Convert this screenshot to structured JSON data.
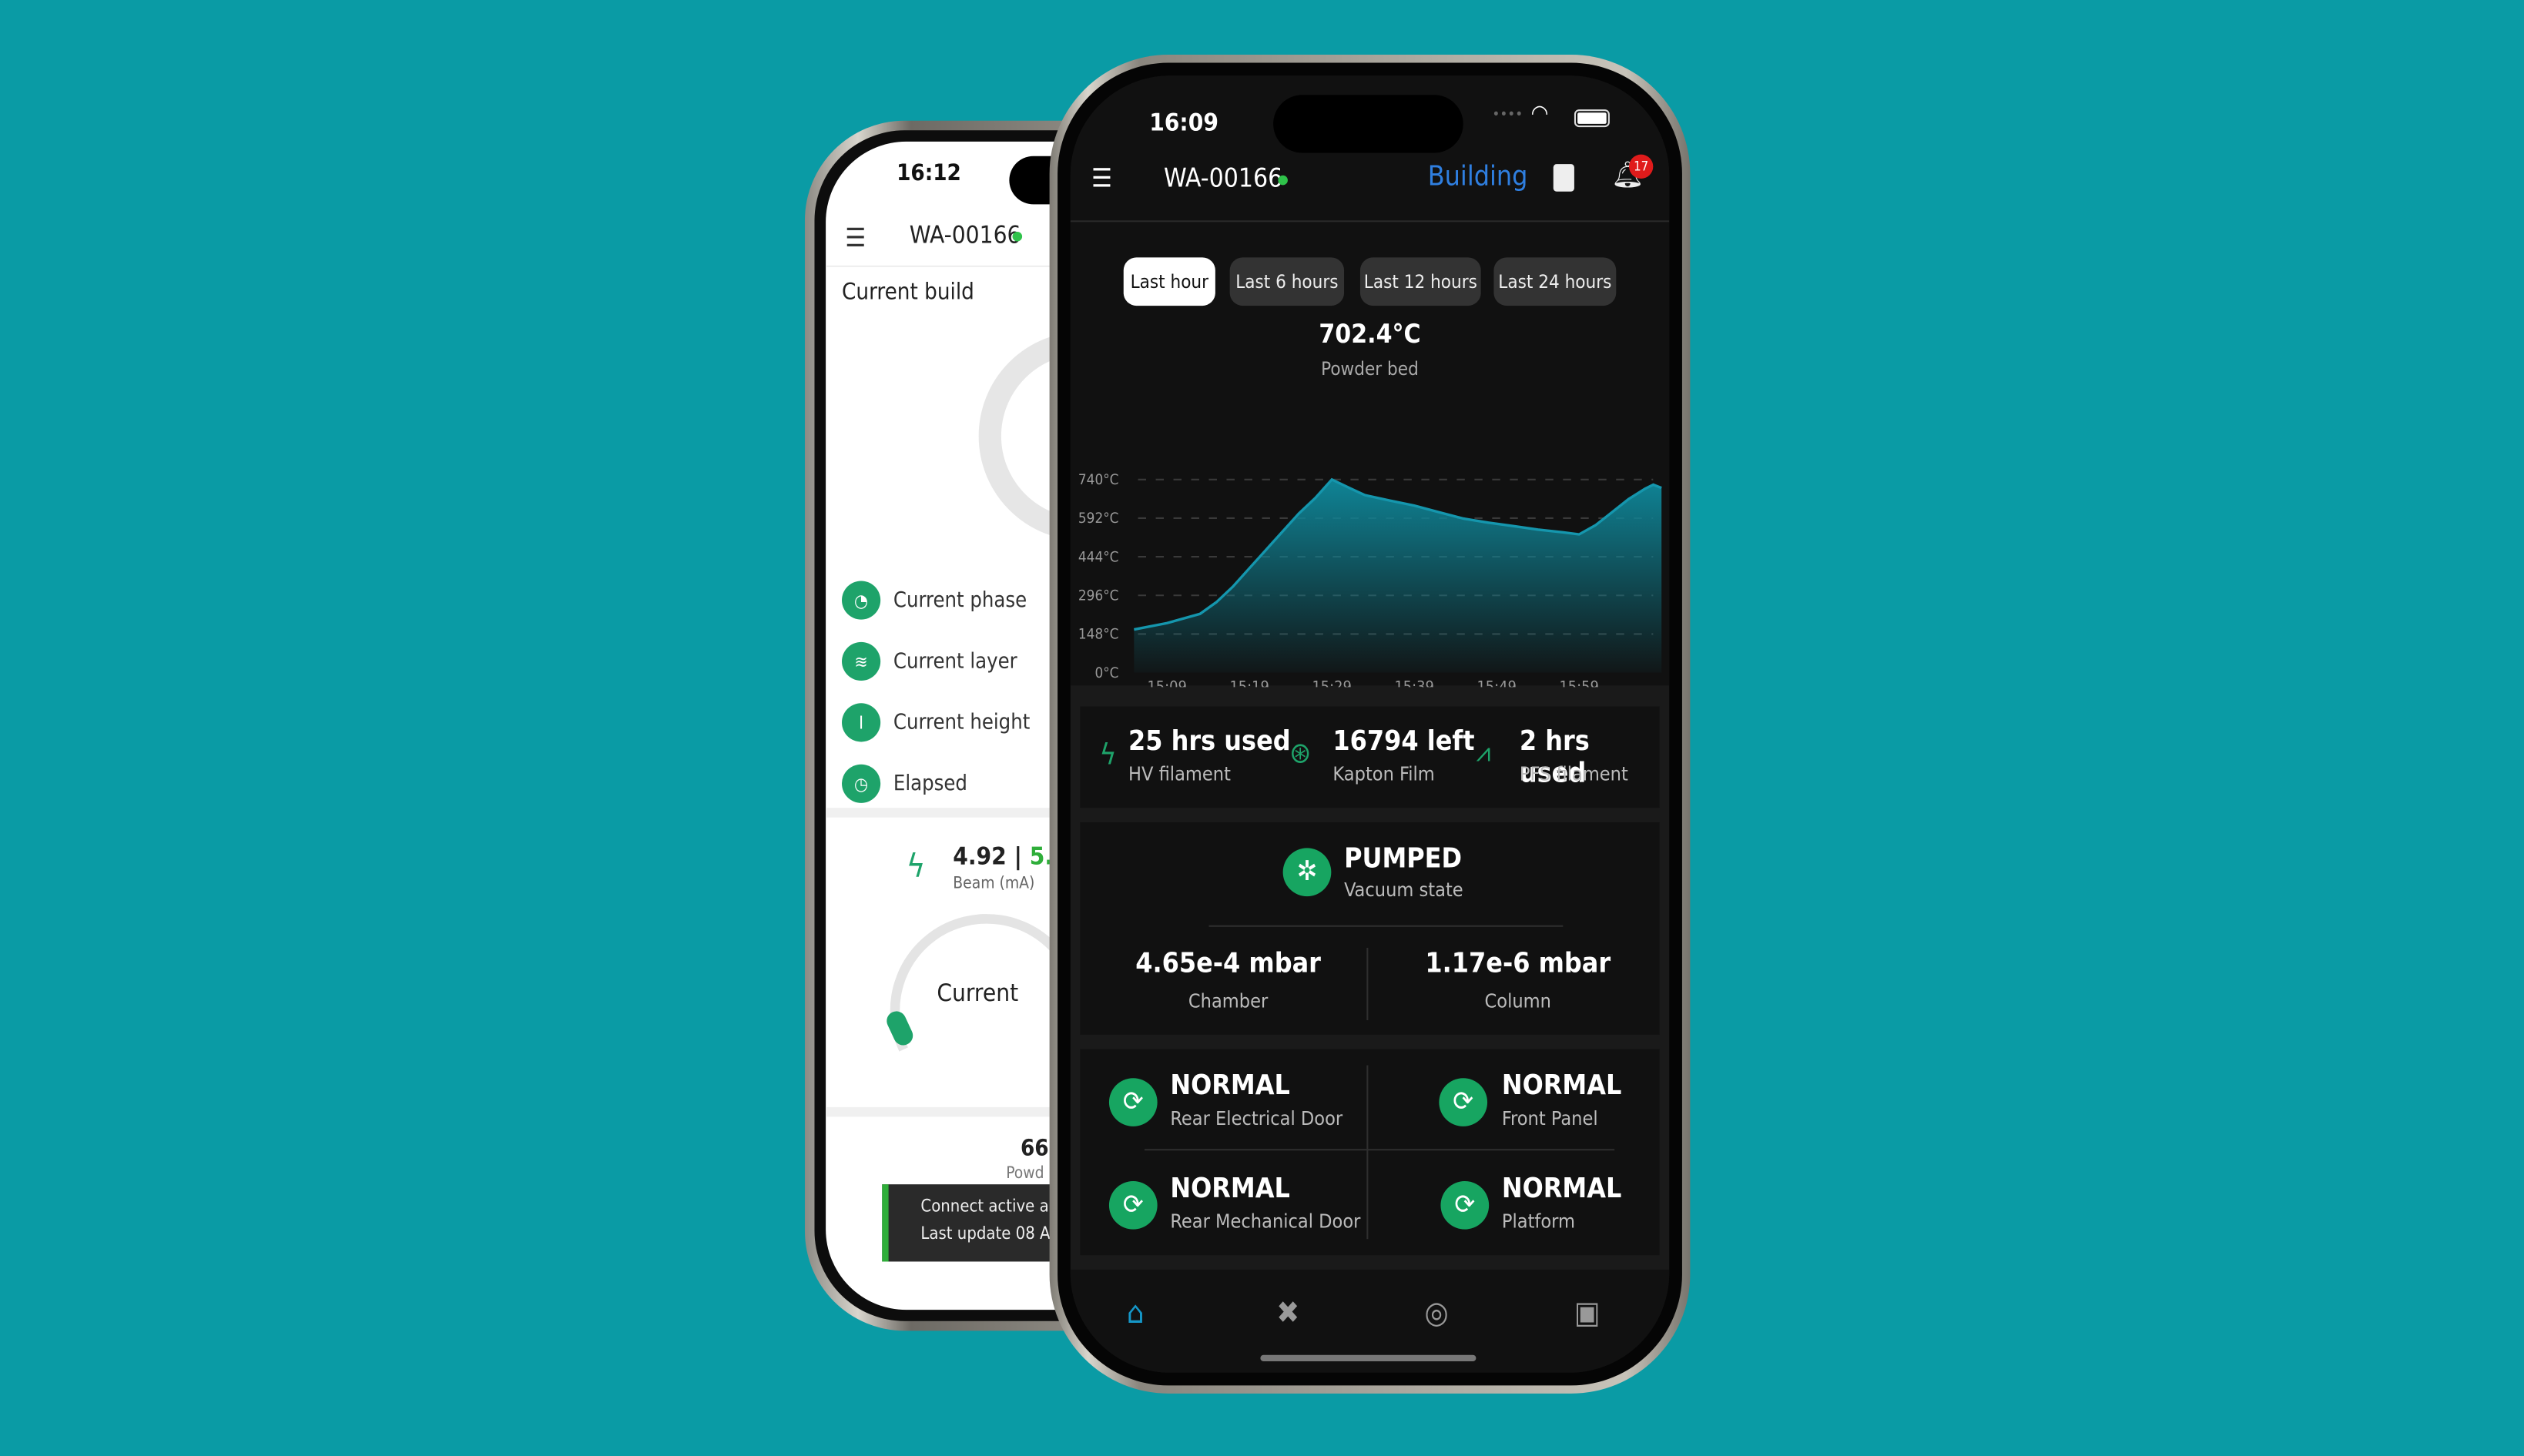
{
  "left_phone": {
    "status_time": "16:12",
    "device_id": "WA-00166",
    "section_title": "Current build",
    "info_rows": [
      {
        "label": "Current phase",
        "icon": "phase-icon"
      },
      {
        "label": "Current layer",
        "icon": "layers-icon"
      },
      {
        "label": "Current height",
        "icon": "height-icon"
      },
      {
        "label": "Elapsed",
        "icon": "clock-icon"
      }
    ],
    "beam_value": "4.92",
    "beam_separator": "|",
    "beam_target": "5.0",
    "beam_label": "Beam (mA)",
    "gauge_label": "Current",
    "partial_value": "66",
    "partial_label": "Powd",
    "toast_line1": "Connect active ar",
    "toast_line2": "Last update 08 Au"
  },
  "right_phone": {
    "status_time": "16:09",
    "device_id": "WA-00166",
    "online_color": "#2fc24a",
    "status": "Building",
    "status_color": "#2f7fe0",
    "notification_count": "17",
    "time_ranges": [
      "Last hour",
      "Last 6 hours",
      "Last 12 hours",
      "Last 24 hours"
    ],
    "selected_range": "Last hour",
    "current_value": "702.4°C",
    "current_label": "Powder bed",
    "consumables": [
      {
        "value": "25 hrs used",
        "label": "HV filament",
        "icon": "lightning-icon"
      },
      {
        "value": "16794 left",
        "label": "Kapton Film",
        "icon": "film-reel-icon"
      },
      {
        "value": "2 hrs used",
        "label": "PFS filament",
        "icon": "filament-icon"
      }
    ],
    "vacuum": {
      "state": "PUMPED",
      "label": "Vacuum state",
      "chamber_value": "4.65e-4 mbar",
      "chamber_label": "Chamber",
      "column_value": "1.17e-6 mbar",
      "column_label": "Column"
    },
    "interlocks": [
      {
        "state": "NORMAL",
        "label": "Rear Electrical Door"
      },
      {
        "state": "NORMAL",
        "label": "Front Panel"
      },
      {
        "state": "NORMAL",
        "label": "Rear Mechanical Door"
      },
      {
        "state": "NORMAL",
        "label": "Platform"
      }
    ],
    "nav": [
      {
        "name": "home",
        "active": true
      },
      {
        "name": "tools",
        "active": false
      },
      {
        "name": "target",
        "active": false
      },
      {
        "name": "dashboard",
        "active": false
      }
    ]
  },
  "chart_data": {
    "type": "area",
    "y_ticks": [
      "0°C",
      "148°C",
      "296°C",
      "444°C",
      "592°C",
      "740°C"
    ],
    "ylim": [
      0,
      740
    ],
    "x_ticks": [
      "15:09",
      "15:19",
      "15:29",
      "15:39",
      "15:49",
      "15:59"
    ],
    "grid": "dashed horizontal",
    "line_color": "#1596ad",
    "points": [
      [
        "15:05",
        165
      ],
      [
        "15:09",
        190
      ],
      [
        "15:13",
        225
      ],
      [
        "15:15",
        270
      ],
      [
        "15:17",
        330
      ],
      [
        "15:19",
        400
      ],
      [
        "15:21",
        470
      ],
      [
        "15:23",
        540
      ],
      [
        "15:25",
        610
      ],
      [
        "15:27",
        670
      ],
      [
        "15:29",
        740
      ],
      [
        "15:31",
        710
      ],
      [
        "15:33",
        680
      ],
      [
        "15:36",
        660
      ],
      [
        "15:39",
        640
      ],
      [
        "15:42",
        615
      ],
      [
        "15:45",
        590
      ],
      [
        "15:48",
        575
      ],
      [
        "15:51",
        562
      ],
      [
        "15:54",
        548
      ],
      [
        "15:57",
        538
      ],
      [
        "15:59",
        530
      ],
      [
        "16:01",
        565
      ],
      [
        "16:03",
        615
      ],
      [
        "16:05",
        665
      ],
      [
        "16:07",
        705
      ],
      [
        "16:08",
        720
      ],
      [
        "16:09",
        708
      ]
    ]
  }
}
